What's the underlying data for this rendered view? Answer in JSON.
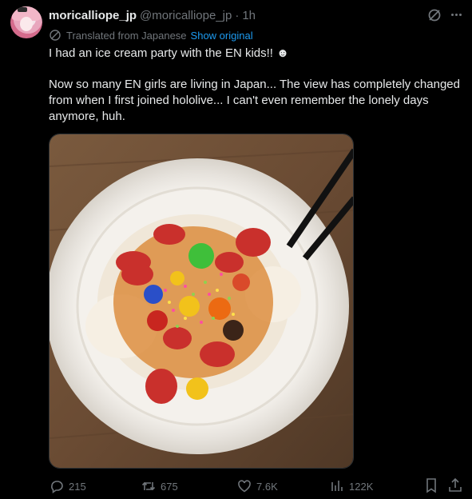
{
  "author": {
    "display_name": "moricalliope_jp",
    "handle": "@moricalliope_jp",
    "separator": "·",
    "time": "1h"
  },
  "translation": {
    "label": "Translated from Japanese",
    "show_original": "Show original"
  },
  "post": {
    "line1": "I had an ice cream party with the EN kids!! ☻",
    "line2": "Now so many EN girls are living in Japan... The view has completely changed",
    "line3": "from when I first joined hololive... I can't even remember the lonely days",
    "line4": "anymore, huh."
  },
  "actions": {
    "replies": "215",
    "reposts": "675",
    "likes": "7.6K",
    "views": "122K"
  },
  "colors": {
    "background": "#000000",
    "text": "#e7e9ea",
    "secondary": "#71767b",
    "link": "#1d9bf0"
  }
}
